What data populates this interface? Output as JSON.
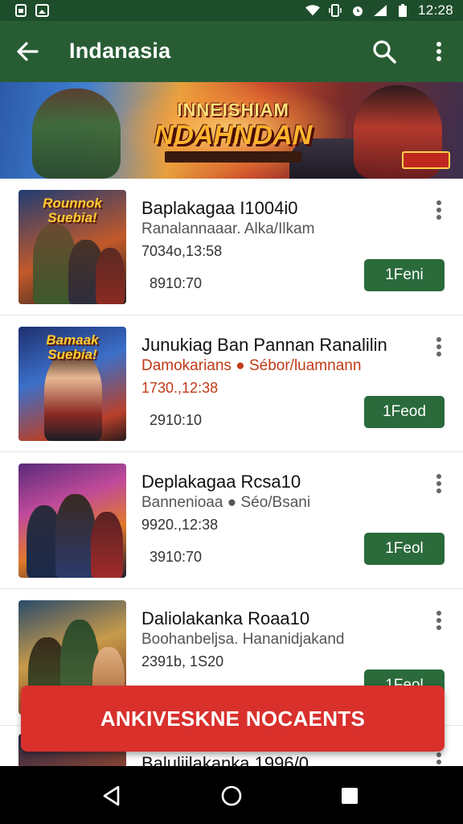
{
  "status_bar": {
    "time": "12:28",
    "icons": [
      "sim-card-icon",
      "photo-icon",
      "wifi-icon",
      "vibrate-icon",
      "alarm-icon",
      "signal-icon",
      "battery-icon"
    ]
  },
  "app_bar": {
    "title": "Indanasia",
    "icons": [
      "back-arrow-icon",
      "search-icon",
      "more-vert-icon"
    ]
  },
  "banner": {
    "logo_line1": "INNEISHIAM",
    "logo_line2": "NDAHNDAN"
  },
  "items": [
    {
      "thumb_title": "Rounnok Suebia!",
      "title": "Baplakagaa I1004i0",
      "subtitle": "Ranalannaaar. Alka/Ilkam",
      "date": "7034o,13:58",
      "count": "8910:70",
      "button": "1Feni"
    },
    {
      "thumb_title": "Bamaak Suebia!",
      "title": "Junukiag Ban Pannan Ranalilin",
      "subtitle": "Damokarians ● Sébor/luamnann",
      "date": "1730.,12:38",
      "count": "2910:10",
      "button": "1Feod"
    },
    {
      "thumb_title": "",
      "title": "Deplakagaa Rcsa10",
      "subtitle": "Bannenioaa ● Séo/Bsani",
      "date": "9920.,12:38",
      "count": "3910:70",
      "button": "1Feol"
    },
    {
      "thumb_title": "",
      "title": "Daliolakanka Roaa10",
      "subtitle": "Boohanbeljsa. Hananidjakand",
      "date": "2391b, 1S20",
      "count": "",
      "button": "1Feol"
    },
    {
      "thumb_title": "",
      "title": "Baluliilakanka 1996/0",
      "subtitle": "",
      "date": "",
      "count": "",
      "button": ""
    }
  ],
  "snackbar": {
    "text": "ANKIVESKNE NOCAENTS"
  },
  "colors": {
    "status_bar": "#1d4d2b",
    "app_bar": "#285d34",
    "button": "#2a6a3b",
    "snackbar": "#d9302c",
    "accent_text": "#c03a16"
  },
  "nav_bar": {
    "icons": [
      "back-triangle-icon",
      "home-circle-icon",
      "recents-square-icon"
    ]
  }
}
